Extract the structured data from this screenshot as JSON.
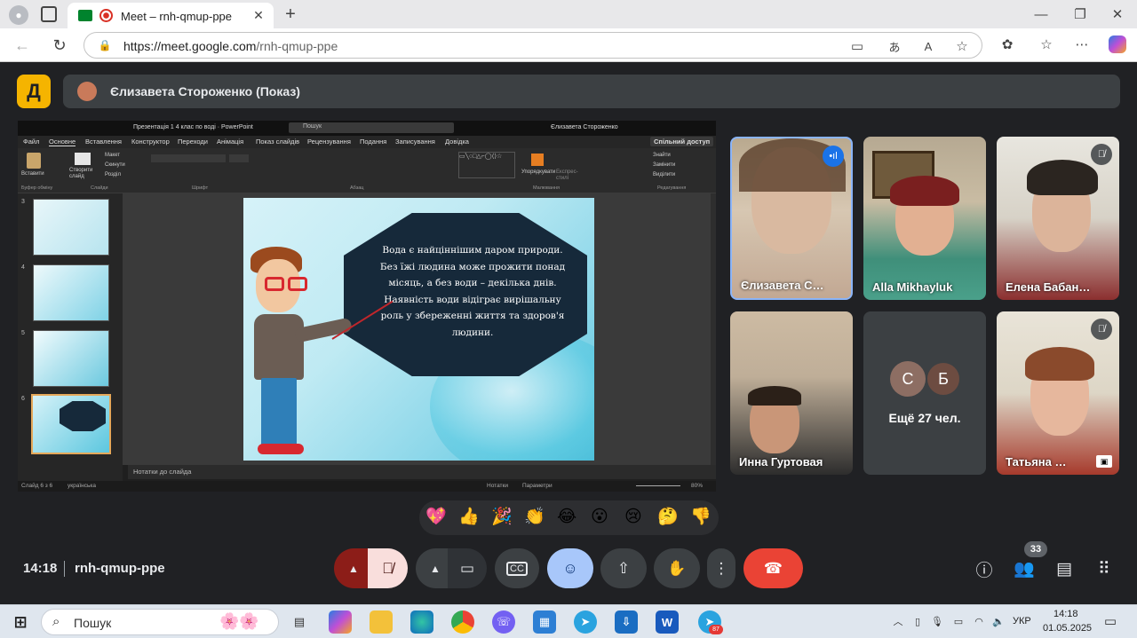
{
  "browser": {
    "tab_title": "Meet – rnh-qmup-ppe",
    "url_host": "https://meet.google.com",
    "url_path": "/rnh-qmup-ppe"
  },
  "meet": {
    "presenter_label": "Єлизавета Стороженко (Показ)",
    "logo_glyph": "Д",
    "meeting_time": "14:18",
    "meeting_code": "rnh-qmup-ppe",
    "participant_count": "33",
    "accent_hangup": "#ea4335",
    "accent_emoji_button": "#a8c7fa"
  },
  "ppt": {
    "title": "Презентація 1 4 клас по воді · PowerPoint",
    "search": "Пошук",
    "user": "Єлизавета Стороженко",
    "menu": [
      "Файл",
      "Основне",
      "Вставлення",
      "Конструктор",
      "Переходи",
      "Анімація",
      "Показ слайдів",
      "Рецензування",
      "Подання",
      "Записування",
      "Довідка"
    ],
    "share_button": "Спільний доступ",
    "ribbon_groups": [
      "Буфер обміну",
      "Слайди",
      "Шрифт",
      "Абзац",
      "Малювання",
      "Редагування"
    ],
    "ribbon_items": [
      "Вставити",
      "Створити слайд",
      "Макет",
      "Скинути",
      "Розділ",
      "Упорядкувати",
      "Експрес-стилі",
      "Знайти",
      "Замінити",
      "Виділити"
    ],
    "thumb_numbers": [
      "3",
      "4",
      "5",
      "6"
    ],
    "notes_label": "Нотатки до слайда",
    "status_slide": "Слайд 6 з 6",
    "status_lang": "українська",
    "status_notes": "Нотатки",
    "status_display": "Параметри",
    "status_zoom": "80%",
    "slide_text": "Вода є найціннішим даром природи. Без їжі людина може прожити понад місяць, а без води – декілька днів. Наявність води відіграє вирішальну роль у збереженні життя та здоров'я людини."
  },
  "participants": [
    {
      "name": "Єлизавета С…",
      "muted": false,
      "speaking": true
    },
    {
      "name": "Alla Mikhayluk",
      "muted": false,
      "speaking": false
    },
    {
      "name": "Елена Бабан…",
      "muted": true,
      "speaking": false
    },
    {
      "name": "Инна Гуртовая",
      "muted": false,
      "speaking": false
    },
    {
      "name": "Ещё 27 чел.",
      "avatars": [
        "С",
        "Б"
      ]
    },
    {
      "name": "Татьяна …",
      "muted": true,
      "speaking": false
    }
  ],
  "reactions": [
    "💖",
    "👍",
    "🎉",
    "👏",
    "😂",
    "😮",
    "😢",
    "🤔",
    "👎"
  ],
  "taskbar": {
    "search": "Пошук",
    "lang": "УКР",
    "time": "14:18",
    "date": "01.05.2025",
    "telegram_badge": "87"
  }
}
